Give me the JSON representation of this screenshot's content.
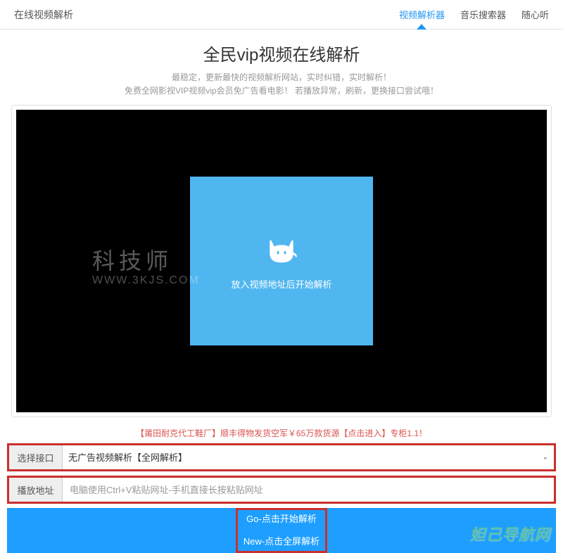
{
  "nav": {
    "title": "在线视频解析",
    "links": [
      "视频解析器",
      "音乐搜索器",
      "随心听"
    ],
    "activeIndex": 0
  },
  "header": {
    "title": "全民vip视频在线解析",
    "subtitle1": "最稳定，更新最快的视频解析网站，实时纠错，实时解析！",
    "subtitle2": "免费全网影视VIP视频vip会员免广告看电影！ 若播放异常，刷新，更换接口尝试哦！"
  },
  "video": {
    "placeholderText": "放入视频地址后开始解析",
    "watermark": "科技师",
    "watermarkSub": "WWW.3KJS.COM"
  },
  "promo": "【莆田耐克代工鞋厂】顺丰得物发货空军￥65万款货源【点击进入】专柜1.1！",
  "form": {
    "interfaceLabel": "选择接口",
    "interfaceValue": "无广告视频解析【全网解析】",
    "addressLabel": "播放地址",
    "addressPlaceholder": "电脑使用Ctrl+V粘贴网址-手机直接长按粘贴网址"
  },
  "buttons": {
    "goLine": "Go-点击开始解析",
    "newLine": "New-点击全屏解析"
  },
  "footerWatermark": "妲己导航网"
}
